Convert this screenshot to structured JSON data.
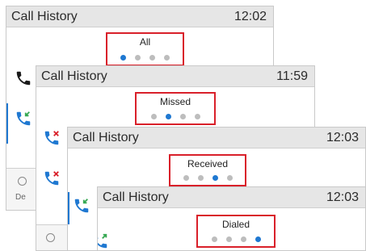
{
  "screens": [
    {
      "title": "Call History",
      "time": "12:02",
      "filter": "All"
    },
    {
      "title": "Call History",
      "time": "11:59",
      "filter": "Missed"
    },
    {
      "title": "Call History",
      "time": "12:03",
      "filter": "Received"
    },
    {
      "title": "Call History",
      "time": "12:03",
      "filter": "Dialed"
    }
  ],
  "softkey_partial_label": "De",
  "colors": {
    "accent": "#1f78d1",
    "highlight": "#d9202a",
    "missed": "#d9202a",
    "received": "#36a852"
  },
  "icons": [
    "phone-icon",
    "missed-call-icon",
    "received-call-icon",
    "dialed-call-icon",
    "delete-icon"
  ]
}
